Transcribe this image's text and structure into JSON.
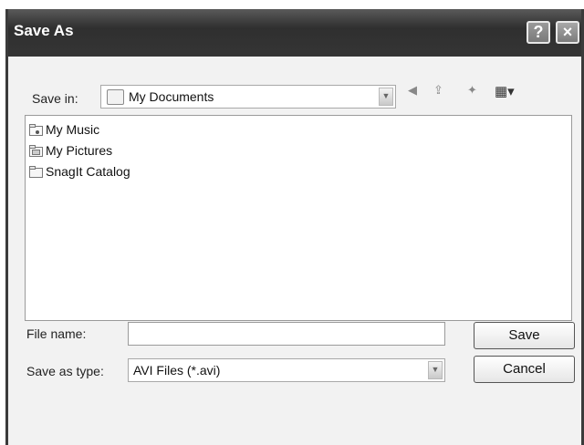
{
  "window": {
    "title": "Save As"
  },
  "titlebar": {
    "help_label": "?",
    "close_label": "×"
  },
  "toolbar": {
    "save_in_label": "Save in:",
    "save_in_value": "My Documents",
    "back_glyph": "◀",
    "up_glyph": "⇪",
    "new_folder_glyph": "✦",
    "views_glyph": "▦▾"
  },
  "file_list": {
    "items": [
      {
        "label": "My Music",
        "icon": "music-folder-icon"
      },
      {
        "label": "My Pictures",
        "icon": "pictures-folder-icon"
      },
      {
        "label": "SnagIt Catalog",
        "icon": "folder-icon"
      }
    ]
  },
  "form": {
    "file_name_label": "File name:",
    "file_name_value": "",
    "save_as_type_label": "Save as type:",
    "save_as_type_value": "AVI Files (*.avi)"
  },
  "buttons": {
    "save_label": "Save",
    "cancel_label": "Cancel"
  }
}
